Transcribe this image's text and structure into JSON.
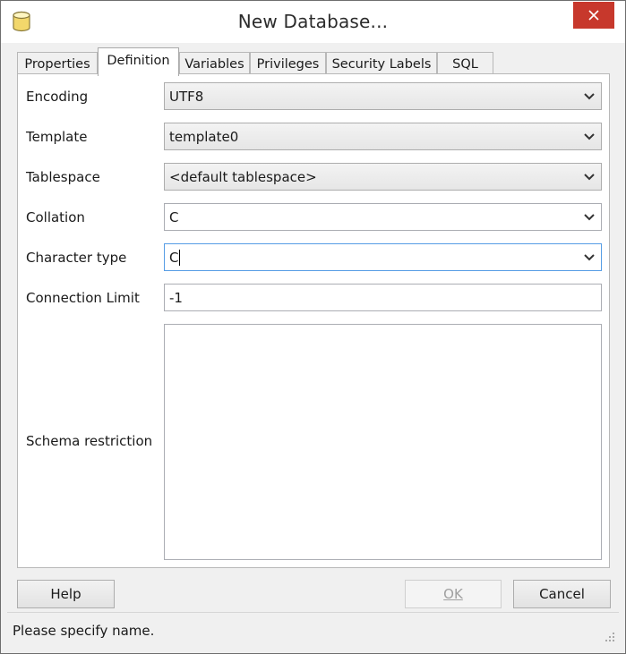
{
  "window": {
    "title": "New Database...",
    "close_icon": "close-icon",
    "app_icon": "database-icon"
  },
  "tabs": [
    {
      "label": "Properties"
    },
    {
      "label": "Definition",
      "active": true
    },
    {
      "label": "Variables"
    },
    {
      "label": "Privileges"
    },
    {
      "label": "Security Labels"
    },
    {
      "label": "SQL"
    }
  ],
  "form": {
    "encoding": {
      "label": "Encoding",
      "value": "UTF8"
    },
    "template": {
      "label": "Template",
      "value": "template0"
    },
    "tablespace": {
      "label": "Tablespace",
      "value": "<default tablespace>"
    },
    "collation": {
      "label": "Collation",
      "value": "C"
    },
    "character_type": {
      "label": "Character type",
      "value": "C"
    },
    "connection_limit": {
      "label": "Connection Limit",
      "value": "-1"
    },
    "schema_restriction": {
      "label": "Schema restriction",
      "value": ""
    }
  },
  "buttons": {
    "help": "Help",
    "ok": "OK",
    "cancel": "Cancel"
  },
  "status": {
    "message": "Please specify name."
  },
  "colors": {
    "close_bg": "#c7382c",
    "focus_border": "#569de5",
    "disabled_text": "#a0a0a0"
  }
}
